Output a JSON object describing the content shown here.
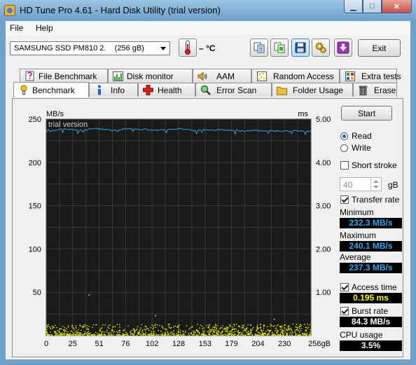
{
  "window": {
    "title": "HD Tune Pro 4.61 - Hard Disk Utility (trial version)"
  },
  "menu": {
    "file": "File",
    "help": "Help"
  },
  "toolbar": {
    "drive": "SAMSUNG SSD PM810 2.    (256 gB)",
    "temperature": "– °C",
    "exit_label": "Exit"
  },
  "tabs_top": [
    {
      "label": "File Benchmark",
      "icon": "file-benchmark-icon"
    },
    {
      "label": "Disk monitor",
      "icon": "disk-monitor-icon"
    },
    {
      "label": "AAM",
      "icon": "speaker-icon"
    },
    {
      "label": "Random Access",
      "icon": "random-access-icon"
    },
    {
      "label": "Extra tests",
      "icon": "extra-tests-icon"
    }
  ],
  "tabs_bottom": [
    {
      "label": "Benchmark",
      "icon": "benchmark-icon"
    },
    {
      "label": "Info",
      "icon": "info-icon"
    },
    {
      "label": "Health",
      "icon": "health-icon"
    },
    {
      "label": "Error Scan",
      "icon": "error-scan-icon"
    },
    {
      "label": "Folder Usage",
      "icon": "folder-icon"
    },
    {
      "label": "Erase",
      "icon": "trash-icon"
    }
  ],
  "side": {
    "start_label": "Start",
    "read_label": "Read",
    "write_label": "Write",
    "mode_selected": "Read",
    "short_stroke_label": "Short stroke",
    "short_stroke_checked": false,
    "short_stroke_value": "40",
    "short_stroke_unit": "gB",
    "transfer_rate_label": "Transfer rate",
    "transfer_rate_checked": true,
    "minimum_label": "Minimum",
    "minimum_value": "232.3 MB/s",
    "maximum_label": "Maximum",
    "maximum_value": "240.1 MB/s",
    "average_label": "Average",
    "average_value": "237.3 MB/s",
    "access_time_label": "Access time",
    "access_time_checked": true,
    "access_time_value": "0.195 ms",
    "burst_rate_label": "Burst rate",
    "burst_rate_checked": true,
    "burst_rate_value": "84.3 MB/s",
    "cpu_usage_label": "CPU usage",
    "cpu_usage_value": "3.5%"
  },
  "colors": {
    "transfer_line": "#29a3e6",
    "access_dots": "#f0f000",
    "value_blue": "#2fa8f0",
    "value_yellow": "#ffff00",
    "value_white": "#ffffff",
    "plot_bg": "#1a1a1a",
    "grid": "#3a3a3a"
  },
  "chart_data": {
    "type": "line",
    "watermark": "trial version",
    "y_left_label": "MB/s",
    "y_right_label": "ms",
    "y_left_ticks": [
      "250",
      "200",
      "150",
      "100",
      "50"
    ],
    "y_right_ticks": [
      "5.00",
      "4.00",
      "3.00",
      "2.00",
      "1.00"
    ],
    "x_ticks": [
      "0",
      "25",
      "51",
      "76",
      "102",
      "128",
      "153",
      "179",
      "204",
      "230",
      "256gB"
    ],
    "x_range": [
      0,
      256
    ],
    "y_left_range": [
      0,
      250
    ],
    "y_right_range": [
      0,
      5
    ],
    "grid": true,
    "series": [
      {
        "name": "Transfer rate",
        "axis": "left",
        "x": [
          0,
          8,
          16,
          24,
          32,
          40,
          48,
          56,
          64,
          72,
          80,
          88,
          96,
          104,
          112,
          120,
          128,
          136,
          144,
          152,
          160,
          168,
          176,
          184,
          192,
          200,
          208,
          216,
          224,
          232,
          240,
          248,
          256
        ],
        "values": [
          238,
          237,
          239,
          238,
          237,
          238,
          239,
          238,
          237,
          238,
          239,
          238,
          238,
          237,
          238,
          238,
          239,
          238,
          237,
          238,
          237,
          238,
          237,
          237,
          236,
          237,
          236,
          237,
          236,
          236,
          237,
          236,
          236
        ]
      },
      {
        "name": "Access time",
        "axis": "right",
        "kind": "scatter",
        "x_range": [
          0,
          256
        ],
        "typical_ms": [
          0.02,
          0.28
        ],
        "outliers": [
          {
            "x": 41,
            "y": 0.95
          },
          {
            "x": 105,
            "y": 0.47
          },
          {
            "x": 220,
            "y": 0.39
          }
        ]
      }
    ]
  }
}
